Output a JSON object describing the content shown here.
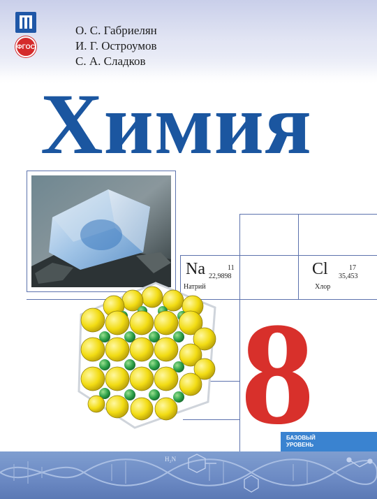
{
  "publisher": {
    "logo_icon": "publisher-logo-icon",
    "fgos_badge": "ФГОС"
  },
  "authors": [
    "О. С. Габриелян",
    "И. Г. Остроумов",
    "С. А. Сладков"
  ],
  "title": "Химия",
  "elements": [
    {
      "symbol": "Na",
      "number": "11",
      "mass": "22,9898",
      "name": "Натрий"
    },
    {
      "symbol": "Cl",
      "number": "17",
      "mass": "35,453",
      "name": "Хлор"
    }
  ],
  "grade": "8",
  "level": [
    "БАЗОВЫЙ",
    "УРОВЕНЬ"
  ],
  "formula_label": "H₂N",
  "colors": {
    "title": "#1b56a0",
    "grade": "#d8302b",
    "level_box": "#3a83d0",
    "bottom_band": "#6b89c3"
  }
}
